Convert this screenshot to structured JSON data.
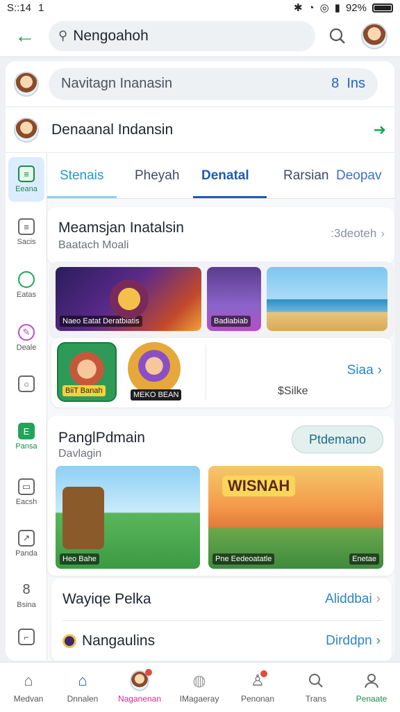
{
  "status": {
    "time": "S::14",
    "signal_mark": "1",
    "right": "92%"
  },
  "topbar": {
    "search_value": "Nengoahoh"
  },
  "nav": {
    "pill_text": "Navitagn Inanasin",
    "pill_count": "8",
    "pill_unit": "Ins"
  },
  "user": {
    "name": "Denaanal Indansin"
  },
  "tabs": [
    "Stenais",
    "Pheyah",
    "Denatal",
    "Rarsian",
    "Deopav"
  ],
  "sidebar": [
    "Eeana",
    "Sacis",
    "Eatas",
    "Deale",
    "",
    "Pansa",
    "Eacsh",
    "Panda",
    "Bsina",
    ""
  ],
  "section1": {
    "title": "Meamsjan Inatalsin",
    "subtitle": "Baatach Moali",
    "link": ":3deoteh",
    "thumb_caps": [
      "Naeo Eatat Deratbiatis",
      "Badiabiab",
      ""
    ],
    "hero_caps": [
      "BiiT Banah",
      "MEKO BEAN"
    ],
    "side_link": "Siaa",
    "side_text": "$Silke"
  },
  "section2": {
    "title": "PanglPdmain",
    "subtitle": "Davlagin",
    "button": "Ptdemano",
    "fiesta_title": "WISNAH",
    "thumb_caps": [
      "Heo Bahe",
      "Pne Eedeoatatle"
    ],
    "badge": "Enetae"
  },
  "rows": [
    {
      "left": "Wayiqe Pelka",
      "right": "Aliddbai"
    },
    {
      "left": "Nangaulins",
      "right": "Dirddpn"
    }
  ],
  "bottom_nav": [
    "Medvan",
    "Dnnalen",
    "Naganenan",
    "IMagaeray",
    "Penonan",
    "Trans",
    "Penaate"
  ]
}
